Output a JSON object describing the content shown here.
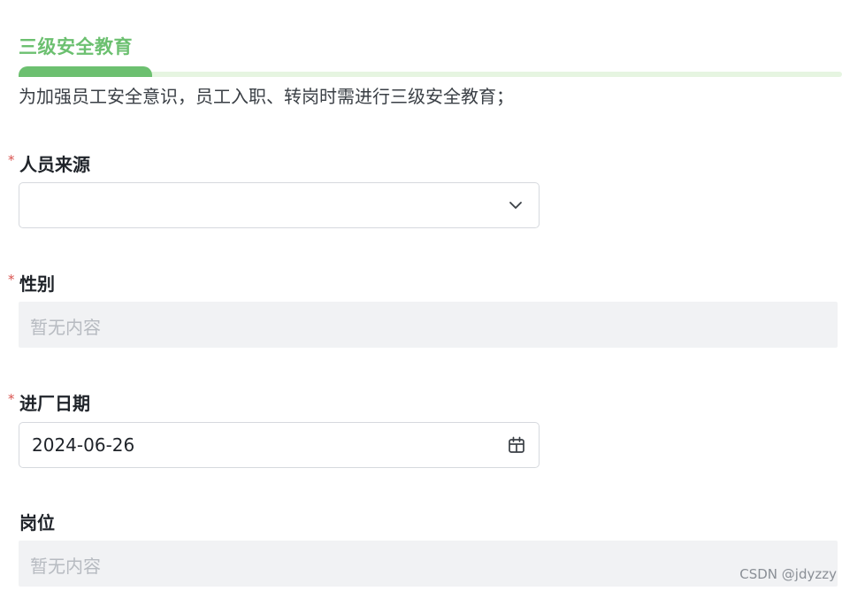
{
  "section": {
    "title": "三级安全教育",
    "description": "为加强员工安全意识，员工入职、转岗时需进行三级安全教育；"
  },
  "fields": {
    "source": {
      "required_mark": "*",
      "label": "人员来源",
      "value": ""
    },
    "gender": {
      "required_mark": "*",
      "label": "性别",
      "value": "暂无内容"
    },
    "entry_date": {
      "required_mark": "*",
      "label": "进厂日期",
      "value": "2024-06-26"
    },
    "position": {
      "label": "岗位",
      "value": "暂无内容"
    }
  },
  "watermark": "CSDN @jdyzzy",
  "colors": {
    "accent_green": "#6cc070",
    "required_red": "#d9534f",
    "placeholder_gray": "#b7bbc1"
  },
  "icons": {
    "select": "chevron-down-icon",
    "date": "calendar-icon"
  }
}
